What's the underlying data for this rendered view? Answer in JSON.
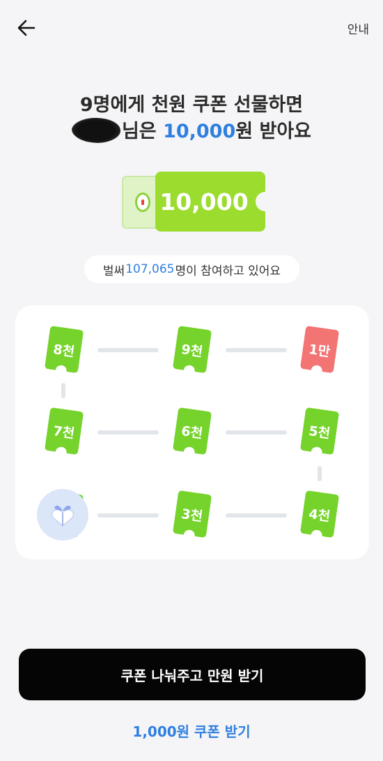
{
  "header": {
    "back_icon": "arrow-left-icon",
    "info_label": "안내"
  },
  "headline": {
    "line1": "9명에게 천원 쿠폰 선물하면",
    "line2_suffix": "님은 ",
    "line2_amount": "10,000",
    "line2_end": "원 받아요"
  },
  "hero_coupon": {
    "amount": "10,000",
    "accent": "#9bdc2f"
  },
  "participation": {
    "prefix": "벌써 ",
    "count": "107,065",
    "suffix": "명이 참여하고 있어요"
  },
  "steps": [
    {
      "label": "8천",
      "state": "green"
    },
    {
      "label": "9천",
      "state": "green"
    },
    {
      "label": "1만",
      "state": "red"
    },
    {
      "label": "7천",
      "state": "green"
    },
    {
      "label": "6천",
      "state": "green"
    },
    {
      "label": "5천",
      "state": "green"
    },
    {
      "label": "",
      "state": "current",
      "icon": "gift-box-icon"
    },
    {
      "label": "3천",
      "state": "green"
    },
    {
      "label": "4천",
      "state": "green"
    }
  ],
  "cta": {
    "primary_label": "쿠폰 나눠주고 만원 받기",
    "secondary_label": "1,000원 쿠폰 받기"
  },
  "colors": {
    "blue": "#2f7fe0",
    "green": "#75d32b",
    "red": "#f27574",
    "black": "#050505"
  }
}
